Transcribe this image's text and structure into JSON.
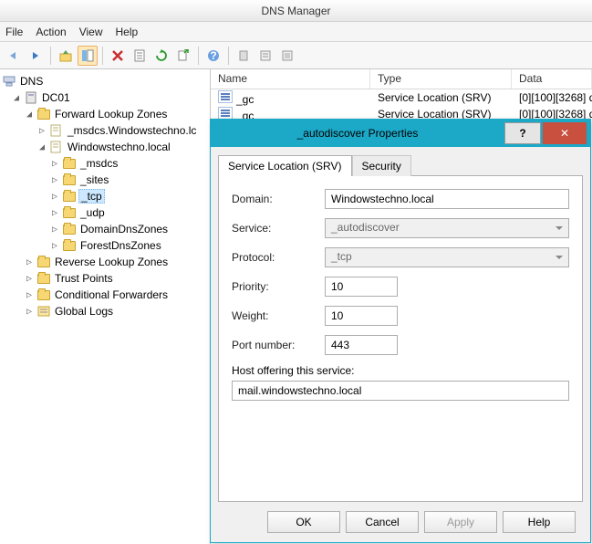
{
  "window": {
    "title": "DNS Manager"
  },
  "menu": {
    "file": "File",
    "action": "Action",
    "view": "View",
    "help": "Help"
  },
  "tree": {
    "root": "DNS",
    "server": "DC01",
    "flz": "Forward Lookup Zones",
    "msdcs_zone": "_msdcs.Windowstechno.lc",
    "main_zone": "Windowstechno.local",
    "msdcs": "_msdcs",
    "sites": "_sites",
    "tcp": "_tcp",
    "udp": "_udp",
    "ddz": "DomainDnsZones",
    "fdz": "ForestDnsZones",
    "rlz": "Reverse Lookup Zones",
    "tp": "Trust Points",
    "cf": "Conditional Forwarders",
    "gl": "Global Logs"
  },
  "list": {
    "cols": {
      "name": "Name",
      "type": "Type",
      "data": "Data"
    },
    "rows": [
      {
        "name": "_gc",
        "type": "Service Location (SRV)",
        "data": "[0][100][3268] d"
      },
      {
        "name": "_gc",
        "type": "Service Location (SRV)",
        "data": "[0][100][3268] d"
      }
    ]
  },
  "dialog": {
    "title": "_autodiscover Properties",
    "tab_srv": "Service Location (SRV)",
    "tab_sec": "Security",
    "domain_label": "Domain:",
    "domain_value": "Windowstechno.local",
    "service_label": "Service:",
    "service_value": "_autodiscover",
    "protocol_label": "Protocol:",
    "protocol_value": "_tcp",
    "priority_label": "Priority:",
    "priority_value": "10",
    "weight_label": "Weight:",
    "weight_value": "10",
    "port_label": "Port number:",
    "port_value": "443",
    "host_label": "Host offering this service:",
    "host_value": "mail.windowstechno.local",
    "btn_ok": "OK",
    "btn_cancel": "Cancel",
    "btn_apply": "Apply",
    "btn_help": "Help",
    "help_symbol": "?",
    "close_symbol": "✕"
  }
}
